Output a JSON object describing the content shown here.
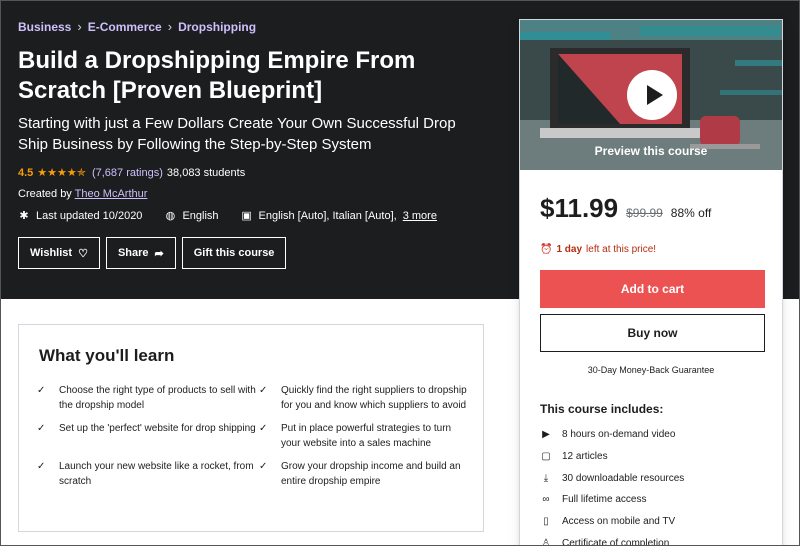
{
  "breadcrumbs": [
    "Business",
    "E-Commerce",
    "Dropshipping"
  ],
  "course": {
    "title": "Build a Dropshipping Empire From Scratch [Proven Blueprint]",
    "subtitle": "Starting with just a Few Dollars Create Your Own Successful Drop Ship Business by Following the Step-by-Step System",
    "rating": "4.5",
    "rating_value": 4.5,
    "ratings_count": "(7,687 ratings)",
    "students": "38,083 students",
    "created_by_label": "Created by",
    "instructor": "Theo McArthur",
    "last_updated": "Last updated 10/2020",
    "language": "English",
    "captions": "English [Auto], Italian [Auto],",
    "captions_more": "3 more"
  },
  "actions": {
    "wishlist": "Wishlist",
    "share": "Share",
    "gift": "Gift this course"
  },
  "sidebar": {
    "preview_label": "Preview this course",
    "price": "$11.99",
    "original_price": "$99.99",
    "discount": "88% off",
    "timer_bold": "1 day",
    "timer_rest": "left at this price!",
    "add_to_cart": "Add to cart",
    "buy_now": "Buy now",
    "guarantee": "30-Day Money-Back Guarantee",
    "includes_title": "This course includes:",
    "includes": [
      {
        "icon": "video-icon",
        "glyph": "▶",
        "label": "8 hours on-demand video"
      },
      {
        "icon": "file-icon",
        "glyph": "▢",
        "label": "12 articles"
      },
      {
        "icon": "download-icon",
        "glyph": "⤓",
        "label": "30 downloadable resources"
      },
      {
        "icon": "infinity-icon",
        "glyph": "∞",
        "label": "Full lifetime access"
      },
      {
        "icon": "mobile-icon",
        "glyph": "▯",
        "label": "Access on mobile and TV"
      },
      {
        "icon": "certificate-icon",
        "glyph": "♙",
        "label": "Certificate of completion"
      }
    ]
  },
  "learn": {
    "title": "What you'll learn",
    "items": [
      "Choose the right type of products to sell with the dropship model",
      "Quickly find the right suppliers to dropship for you and know which suppliers to avoid",
      "Set up the 'perfect' website for drop shipping",
      "Put in place powerful strategies to turn your website into a sales machine",
      "Launch your new website like a rocket, from scratch",
      "Grow your dropship income and build an entire dropship empire"
    ]
  },
  "colors": {
    "hero_bg": "#1c1d1f",
    "link_purple": "#cec0fc",
    "star_orange": "#f69c08",
    "cart_red": "#ec5252",
    "timer_red": "#b32d0f"
  }
}
